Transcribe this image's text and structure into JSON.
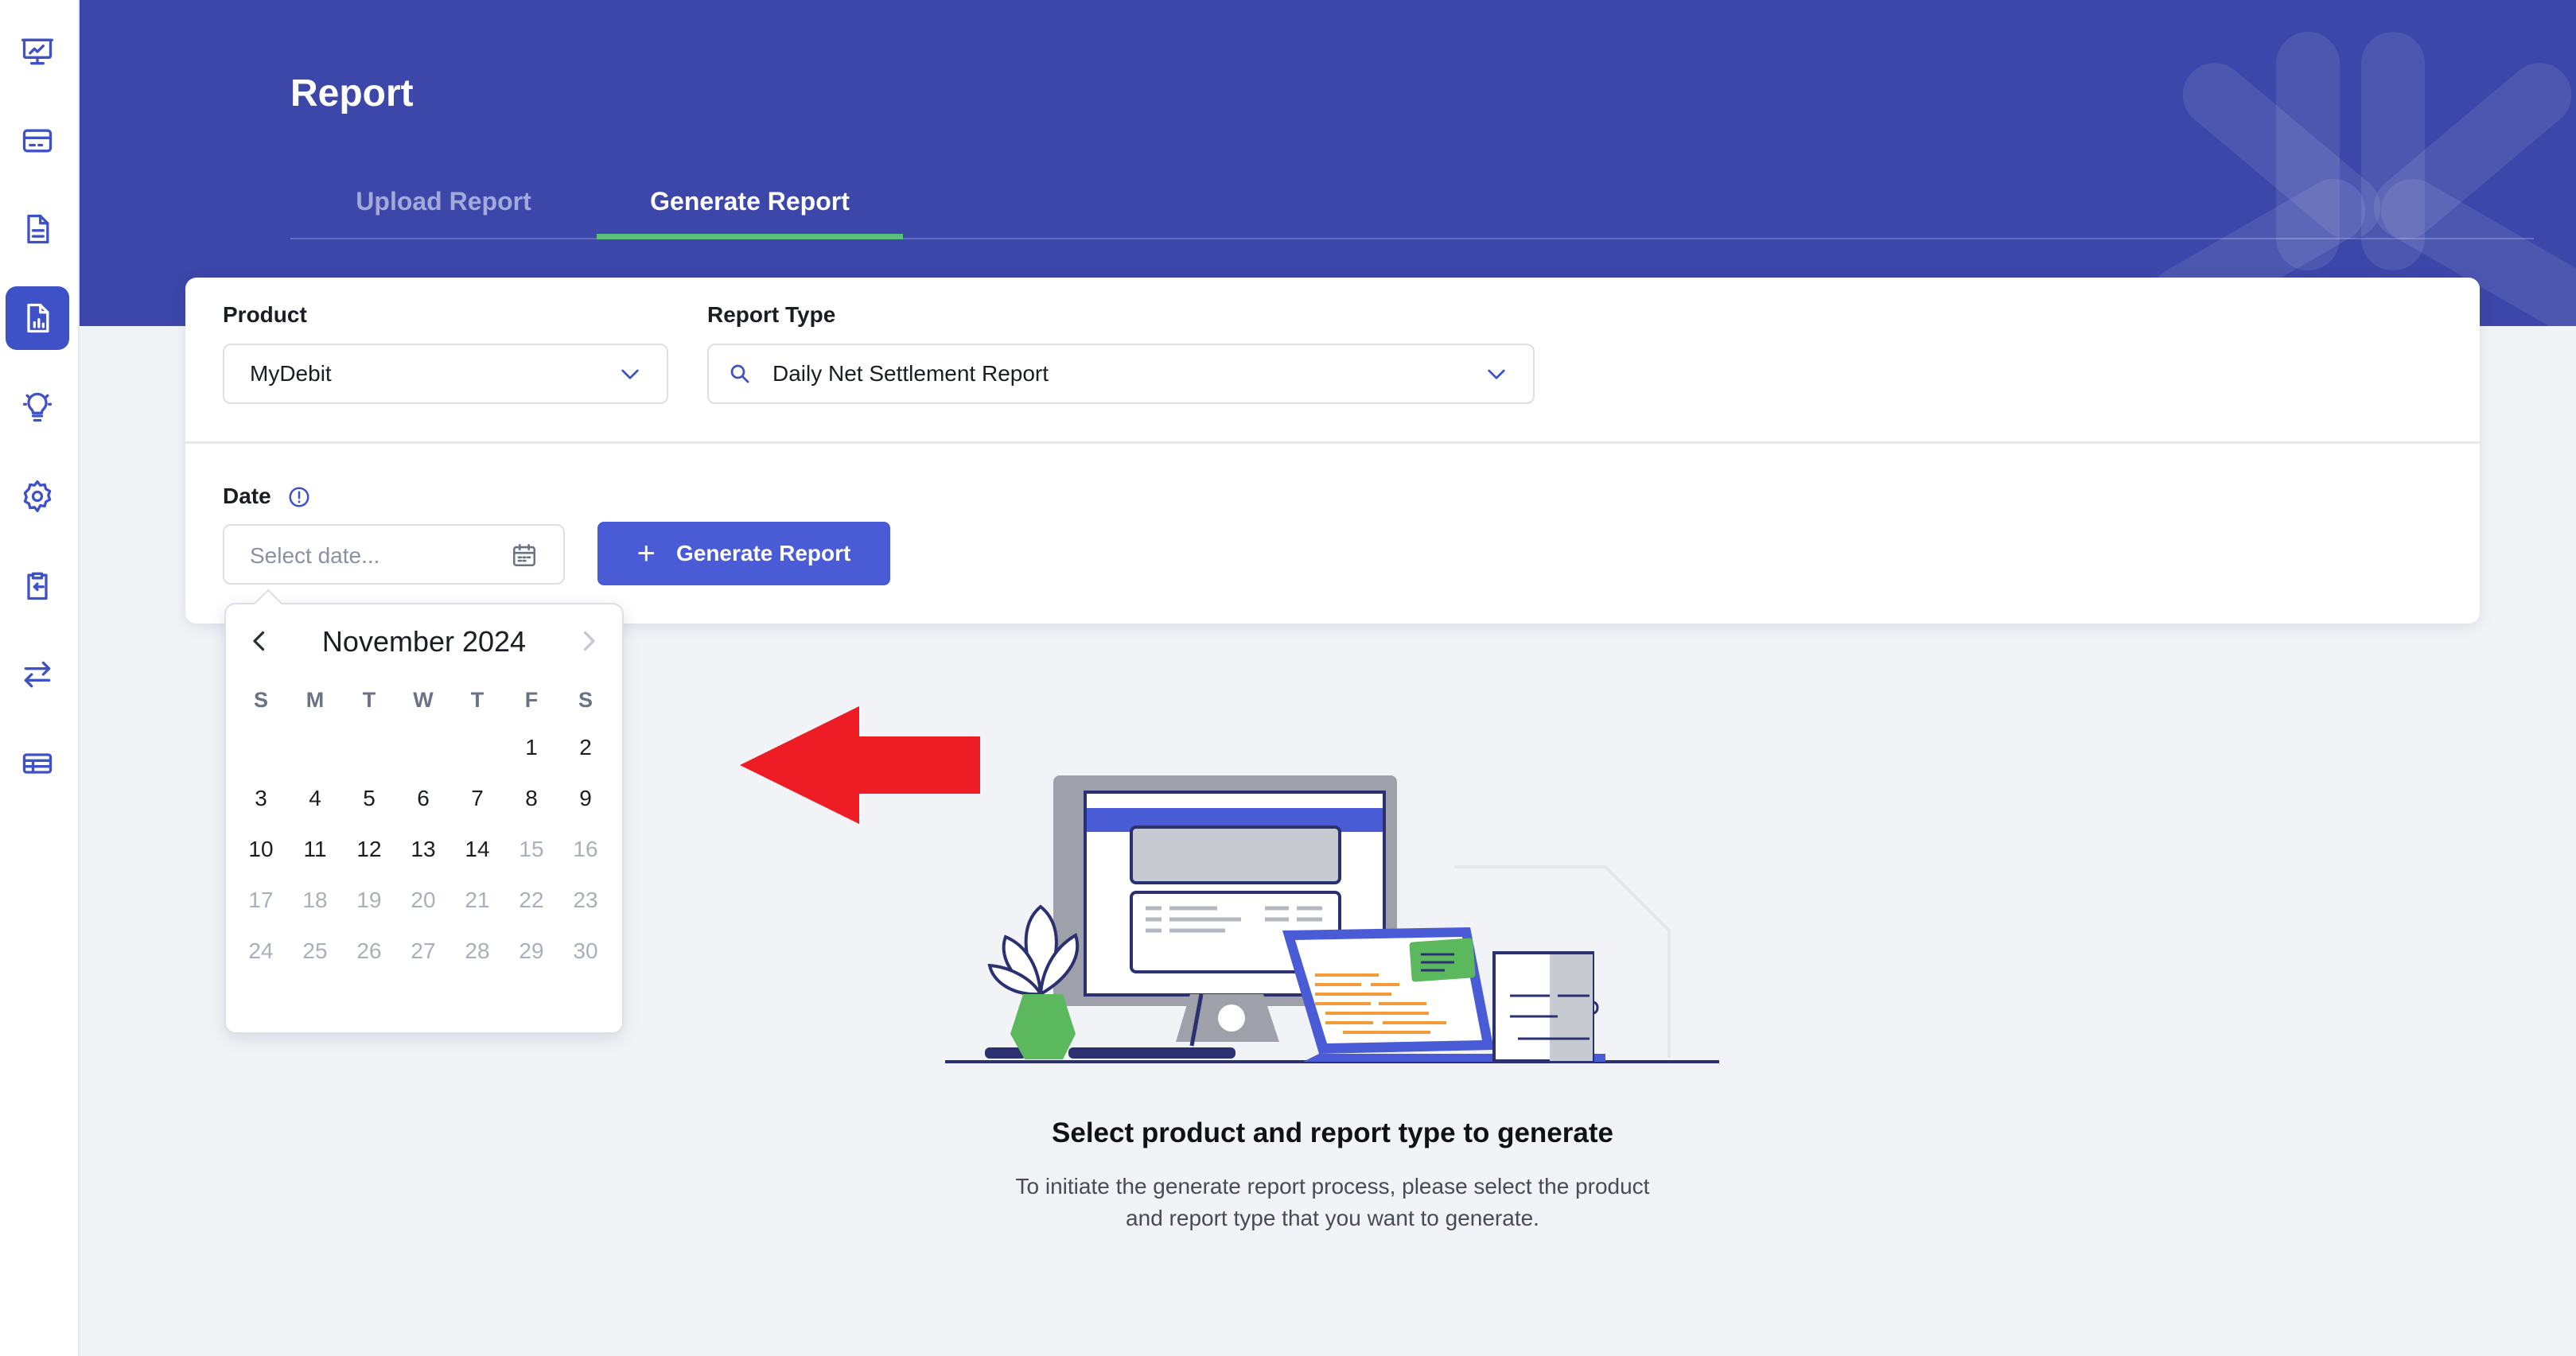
{
  "sidebar": {
    "items": [
      {
        "icon": "presentation-chart-icon",
        "active": false
      },
      {
        "icon": "credit-card-icon",
        "active": false
      },
      {
        "icon": "document-icon",
        "active": false
      },
      {
        "icon": "report-chart-icon",
        "active": true
      },
      {
        "icon": "lightbulb-icon",
        "active": false
      },
      {
        "icon": "gear-icon",
        "active": false
      },
      {
        "icon": "clipboard-return-icon",
        "active": false
      },
      {
        "icon": "transfer-arrows-icon",
        "active": false
      },
      {
        "icon": "table-icon",
        "active": false
      }
    ]
  },
  "header": {
    "title": "Report",
    "tabs": [
      {
        "label": "Upload Report",
        "active": false
      },
      {
        "label": "Generate Report",
        "active": true
      }
    ]
  },
  "form": {
    "product_label": "Product",
    "product_value": "MyDebit",
    "report_type_label": "Report Type",
    "report_type_value": "Daily Net Settlement Report",
    "date_label": "Date",
    "date_placeholder": "Select date...",
    "generate_button": "Generate Report"
  },
  "calendar": {
    "month_label": "November 2024",
    "weekdays": [
      "S",
      "M",
      "T",
      "W",
      "T",
      "F",
      "S"
    ],
    "weeks": [
      [
        "",
        "",
        "",
        "",
        "",
        "1",
        "2"
      ],
      [
        "3",
        "4",
        "5",
        "6",
        "7",
        "8",
        "9"
      ],
      [
        "10",
        "11",
        "12",
        "13",
        "14",
        "15",
        "16"
      ],
      [
        "17",
        "18",
        "19",
        "20",
        "21",
        "22",
        "23"
      ],
      [
        "24",
        "25",
        "26",
        "27",
        "28",
        "29",
        "30"
      ]
    ],
    "last_enabled_day": 14
  },
  "empty_state": {
    "title": "Select product and report type to generate",
    "description": "To initiate the generate report process, please select the product and report type that you want to generate."
  },
  "colors": {
    "header_bg": "#3d47a9",
    "primary": "#4a5bd6",
    "active_tab_underline": "#5dc07a",
    "annotation_arrow": "#ee1c25"
  }
}
